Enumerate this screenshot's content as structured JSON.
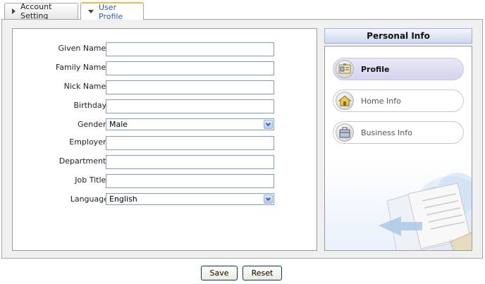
{
  "tabs": [
    {
      "label": "Account Setting",
      "active": false
    },
    {
      "label": "User Profile",
      "active": true
    }
  ],
  "form": {
    "given_name": {
      "label": "Given Name:",
      "value": ""
    },
    "family_name": {
      "label": "Family Name:",
      "value": ""
    },
    "nick_name": {
      "label": "Nick Name:",
      "value": ""
    },
    "birthday": {
      "label": "Birthday:",
      "value": ""
    },
    "gender": {
      "label": "Gender:",
      "value": "Male"
    },
    "employer": {
      "label": "Employer:",
      "value": ""
    },
    "department": {
      "label": "Department:",
      "value": ""
    },
    "job_title": {
      "label": "Job Title:",
      "value": ""
    },
    "language": {
      "label": "Language",
      "value": "English"
    }
  },
  "sidebar": {
    "title": "Personal Info",
    "items": [
      {
        "label": "Profile",
        "icon": "id-card-icon",
        "active": true
      },
      {
        "label": "Home Info",
        "icon": "home-icon",
        "active": false
      },
      {
        "label": "Business Info",
        "icon": "briefcase-icon",
        "active": false
      }
    ]
  },
  "buttons": {
    "save": "Save",
    "reset": "Reset"
  },
  "colors": {
    "active_tab_accent": "#f2b552",
    "active_tab_text": "#2a5ea8",
    "sidebar_header": "#cfd8f0",
    "active_nav": "#d4d4ee",
    "input_border": "#7f9db9"
  }
}
